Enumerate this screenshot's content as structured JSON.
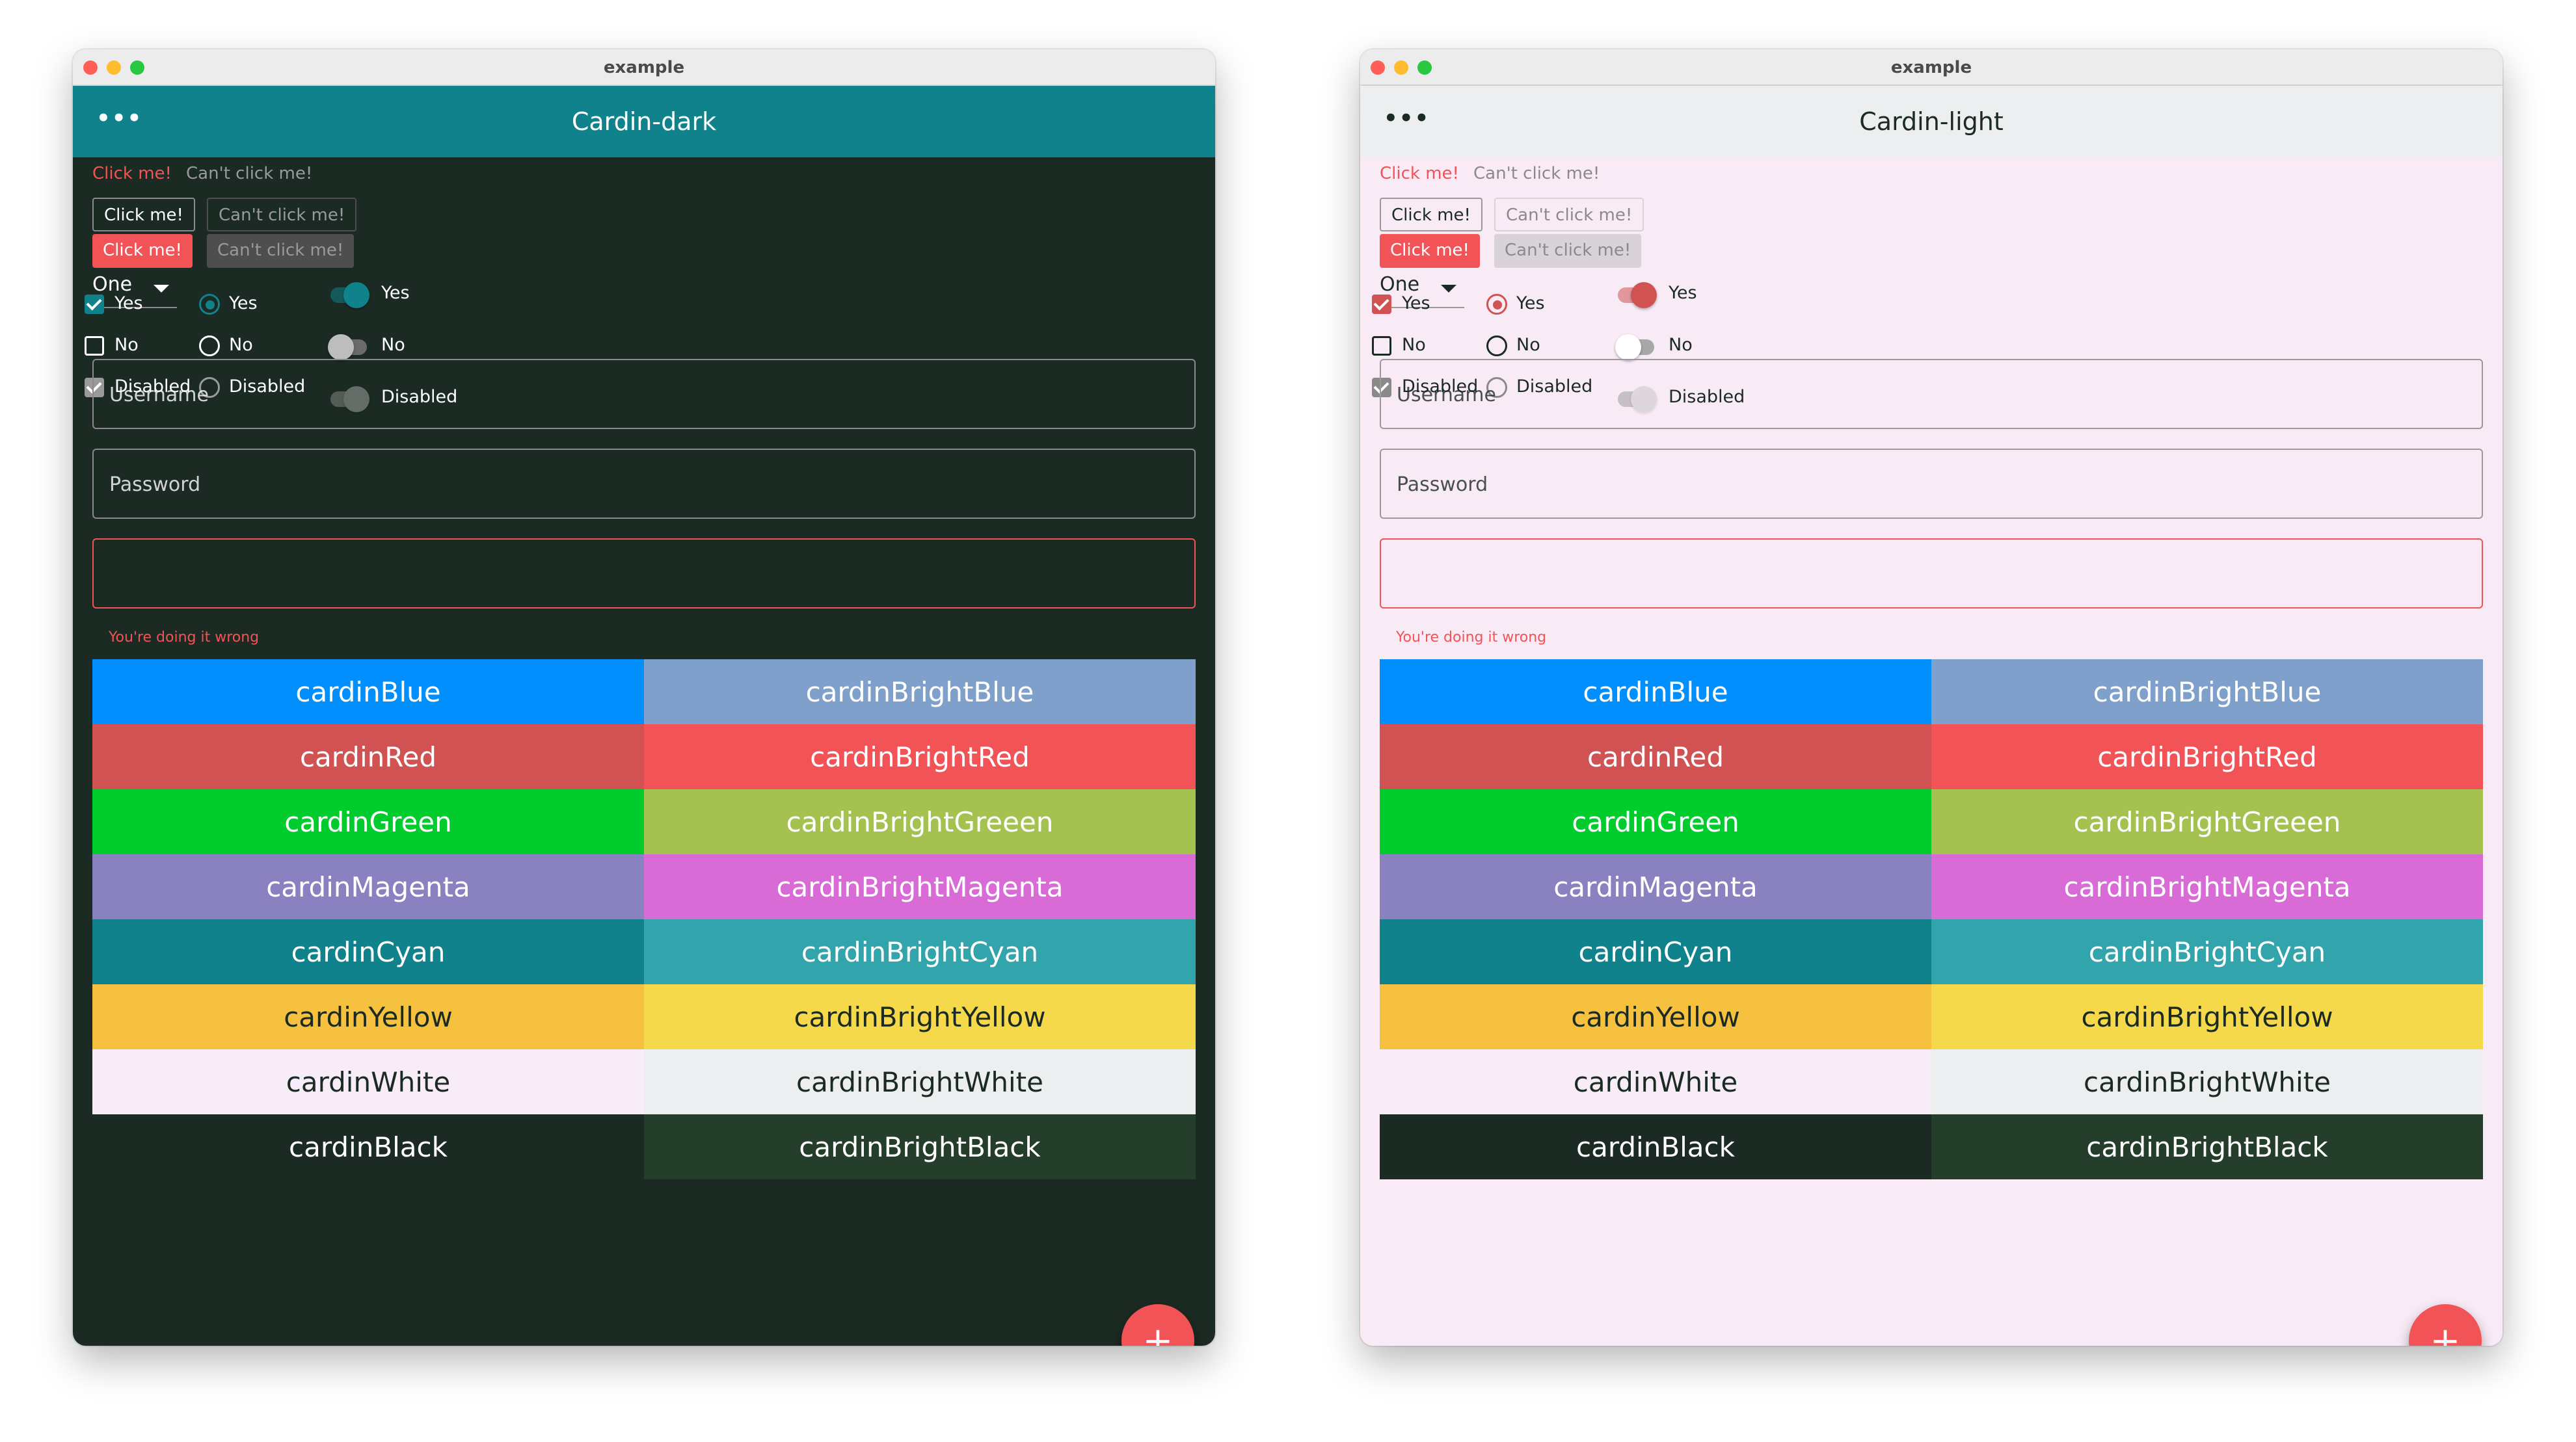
{
  "windows": [
    {
      "id": "dark",
      "window_title": "example",
      "app_title": "Cardin-dark",
      "menu_icon": "more-horizontal-icon",
      "colors": {
        "bg": "#1b2a22",
        "appbar": "#10828b",
        "appbar_text": "#ffffff",
        "text": "#ffffff",
        "accent": "#10828b",
        "muted": "#9a9a9a",
        "border": "#8a8a8a",
        "error": "#f25357",
        "disabled_btn": "#4e4e4e"
      },
      "text_buttons": {
        "enabled": "Click me!",
        "disabled": "Can't click me!"
      },
      "outlined_buttons": {
        "enabled": "Click me!",
        "disabled": "Can't click me!"
      },
      "filled_buttons": {
        "enabled": "Click me!",
        "disabled": "Can't click me!"
      },
      "dropdown": {
        "selected": "One"
      },
      "checkboxes": [
        {
          "label": "Yes",
          "checked": true,
          "disabled": false
        },
        {
          "label": "No",
          "checked": false,
          "disabled": false
        },
        {
          "label": "Disabled",
          "checked": true,
          "disabled": true
        }
      ],
      "radios": [
        {
          "label": "Yes",
          "selected": true,
          "disabled": false
        },
        {
          "label": "No",
          "selected": false,
          "disabled": false
        },
        {
          "label": "Disabled",
          "selected": false,
          "disabled": true
        }
      ],
      "switches": [
        {
          "label": "Yes",
          "on": true,
          "disabled": false
        },
        {
          "label": "No",
          "on": false,
          "disabled": false
        },
        {
          "label": "Disabled",
          "on": true,
          "disabled": true
        }
      ],
      "username": {
        "placeholder": "Username",
        "value": ""
      },
      "password": {
        "placeholder": "Password",
        "value": ""
      },
      "error_field": {
        "value": "",
        "error_text": "You're doing it wrong"
      },
      "fab_icon": "plus-icon",
      "swatches": [
        {
          "label": "cardinBlue",
          "bg": "#008ffd",
          "fg": "#ffffff"
        },
        {
          "label": "cardinBrightBlue",
          "bg": "#7ea0cb",
          "fg": "#ffffff"
        },
        {
          "label": "cardinRed",
          "bg": "#d05253",
          "fg": "#ffffff"
        },
        {
          "label": "cardinBrightRed",
          "bg": "#f25357",
          "fg": "#ffffff"
        },
        {
          "label": "cardinGreen",
          "bg": "#00cc2e",
          "fg": "#ffffff"
        },
        {
          "label": "cardinBrightGreeen",
          "bg": "#a5c150",
          "fg": "#ffffff"
        },
        {
          "label": "cardinMagenta",
          "bg": "#8a81c0",
          "fg": "#ffffff"
        },
        {
          "label": "cardinBrightMagenta",
          "bg": "#d96bd7",
          "fg": "#ffffff"
        },
        {
          "label": "cardinCyan",
          "bg": "#10828b",
          "fg": "#ffffff"
        },
        {
          "label": "cardinBrightCyan",
          "bg": "#32a4ab",
          "fg": "#ffffff"
        },
        {
          "label": "cardinYellow",
          "bg": "#f5c13e",
          "fg": "#1b2a22"
        },
        {
          "label": "cardinBrightYellow",
          "bg": "#f5d94a",
          "fg": "#1b2a22"
        },
        {
          "label": "cardinWhite",
          "bg": "#f7ecf7",
          "fg": "#1b2a22"
        },
        {
          "label": "cardinBrightWhite",
          "bg": "#eceef0",
          "fg": "#1b2a22"
        },
        {
          "label": "cardinBlack",
          "bg": "#1b2a22",
          "fg": "#ffffff"
        },
        {
          "label": "cardinBrightBlack",
          "bg": "#253e2c",
          "fg": "#ffffff"
        }
      ]
    },
    {
      "id": "light",
      "window_title": "example",
      "app_title": "Cardin-light",
      "menu_icon": "more-horizontal-icon",
      "colors": {
        "bg": "#f8ebf6",
        "appbar": "#eceef0",
        "appbar_text": "#1b2a22",
        "text": "#1b2a22",
        "accent": "#d05253",
        "muted": "#8a8a8a",
        "border": "#9a9a9a",
        "error": "#f25357",
        "disabled_btn": "#d9d2d8"
      },
      "text_buttons": {
        "enabled": "Click me!",
        "disabled": "Can't click me!"
      },
      "outlined_buttons": {
        "enabled": "Click me!",
        "disabled": "Can't click me!"
      },
      "filled_buttons": {
        "enabled": "Click me!",
        "disabled": "Can't click me!"
      },
      "dropdown": {
        "selected": "One"
      },
      "checkboxes": [
        {
          "label": "Yes",
          "checked": true,
          "disabled": false
        },
        {
          "label": "No",
          "checked": false,
          "disabled": false
        },
        {
          "label": "Disabled",
          "checked": true,
          "disabled": true
        }
      ],
      "radios": [
        {
          "label": "Yes",
          "selected": true,
          "disabled": false
        },
        {
          "label": "No",
          "selected": false,
          "disabled": false
        },
        {
          "label": "Disabled",
          "selected": false,
          "disabled": true
        }
      ],
      "switches": [
        {
          "label": "Yes",
          "on": true,
          "disabled": false
        },
        {
          "label": "No",
          "on": false,
          "disabled": false
        },
        {
          "label": "Disabled",
          "on": true,
          "disabled": true
        }
      ],
      "username": {
        "placeholder": "Username",
        "value": ""
      },
      "password": {
        "placeholder": "Password",
        "value": ""
      },
      "error_field": {
        "value": "",
        "error_text": "You're doing it wrong"
      },
      "fab_icon": "plus-icon",
      "swatches": [
        {
          "label": "cardinBlue",
          "bg": "#008ffd",
          "fg": "#ffffff"
        },
        {
          "label": "cardinBrightBlue",
          "bg": "#7ea0cb",
          "fg": "#ffffff"
        },
        {
          "label": "cardinRed",
          "bg": "#d05253",
          "fg": "#ffffff"
        },
        {
          "label": "cardinBrightRed",
          "bg": "#f25357",
          "fg": "#ffffff"
        },
        {
          "label": "cardinGreen",
          "bg": "#00cc2e",
          "fg": "#ffffff"
        },
        {
          "label": "cardinBrightGreeen",
          "bg": "#a5c150",
          "fg": "#ffffff"
        },
        {
          "label": "cardinMagenta",
          "bg": "#8a81c0",
          "fg": "#ffffff"
        },
        {
          "label": "cardinBrightMagenta",
          "bg": "#d96bd7",
          "fg": "#ffffff"
        },
        {
          "label": "cardinCyan",
          "bg": "#10828b",
          "fg": "#ffffff"
        },
        {
          "label": "cardinBrightCyan",
          "bg": "#32a4ab",
          "fg": "#ffffff"
        },
        {
          "label": "cardinYellow",
          "bg": "#f5c13e",
          "fg": "#1b2a22"
        },
        {
          "label": "cardinBrightYellow",
          "bg": "#f5d94a",
          "fg": "#1b2a22"
        },
        {
          "label": "cardinWhite",
          "bg": "#f7ecf7",
          "fg": "#1b2a22"
        },
        {
          "label": "cardinBrightWhite",
          "bg": "#eceef0",
          "fg": "#1b2a22"
        },
        {
          "label": "cardinBlack",
          "bg": "#1b2a22",
          "fg": "#ffffff"
        },
        {
          "label": "cardinBrightBlack",
          "bg": "#253e2c",
          "fg": "#ffffff"
        }
      ]
    }
  ]
}
